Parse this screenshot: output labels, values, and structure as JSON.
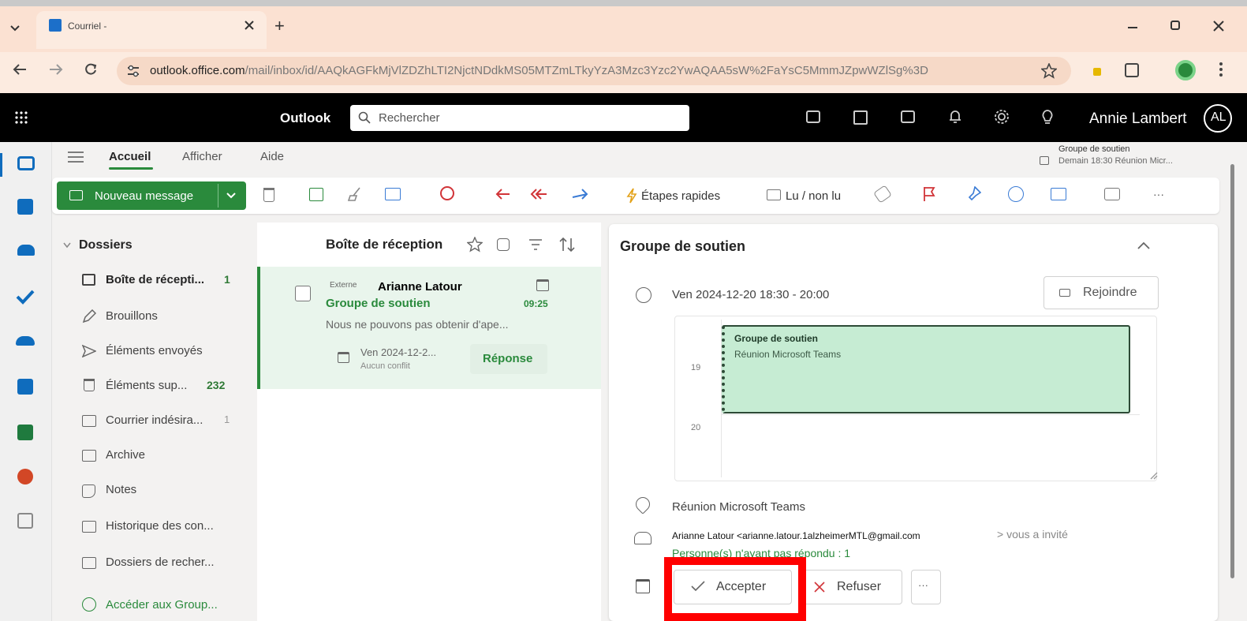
{
  "browser": {
    "tab_title": "Courriel -",
    "new_tab": "+",
    "url_host": "outlook.office.com",
    "url_path": "/mail/inbox/id/AAQkAGFkMjVlZDZhLTI2NjctNDdkMS05MTZmLTkyYzA3Mzc3Yzc2YwAQAA5sW%2FaYsC5MmmJZpwWZlSg%3D"
  },
  "outlook": {
    "app_name": "Outlook",
    "search_placeholder": "Rechercher",
    "user_name": "Annie Lambert",
    "user_initials": "AL",
    "accent": "#2a8a3c"
  },
  "ribbon": {
    "tabs": [
      "Accueil",
      "Afficher",
      "Aide"
    ],
    "new_message": "Nouveau message",
    "quick_steps": "Étapes rapides",
    "read_unread": "Lu / non lu",
    "more": "···",
    "reminder_title": "Groupe de soutien",
    "reminder_detail": "Demain 18:30 Réunion Micr..."
  },
  "folders": {
    "header": "Dossiers",
    "items": [
      {
        "label": "Boîte de récepti...",
        "count": "1"
      },
      {
        "label": "Brouillons",
        "count": ""
      },
      {
        "label": "Éléments envoyés",
        "count": ""
      },
      {
        "label": "Éléments sup...",
        "count": "232"
      },
      {
        "label": "Courrier indésira...",
        "count": "1"
      },
      {
        "label": "Archive",
        "count": ""
      },
      {
        "label": "Notes",
        "count": ""
      },
      {
        "label": "Historique des con...",
        "count": ""
      },
      {
        "label": "Dossiers de recher...",
        "count": ""
      }
    ],
    "groups_link": "Accéder aux Group..."
  },
  "message_list": {
    "title": "Boîte de réception",
    "items": [
      {
        "tag": "Externe",
        "sender": "Arianne Latour",
        "subject": "Groupe de soutien",
        "time": "09:25",
        "preview": "Nous ne pouvons pas obtenir d'ape...",
        "event_date": "Ven 2024-12-2...",
        "event_conflict": "Aucun conflit",
        "reply": "Réponse"
      }
    ]
  },
  "reading": {
    "subject": "Groupe de soutien",
    "datetime": "Ven 2024-12-20 18:30 - 20:00",
    "join": "Rejoindre",
    "hours": [
      "19",
      "20"
    ],
    "event_title": "Groupe de soutien",
    "event_location": "Réunion Microsoft Teams",
    "location": "Réunion Microsoft Teams",
    "organizer": "Arianne Latour <arianne.latour.1alzheimerMTL@gmail.com",
    "invited_suffix": "> vous a invité",
    "no_response": "Personne(s) n'ayant pas répondu : 1",
    "accept": "Accepter",
    "decline": "Refuser",
    "more": "···"
  }
}
